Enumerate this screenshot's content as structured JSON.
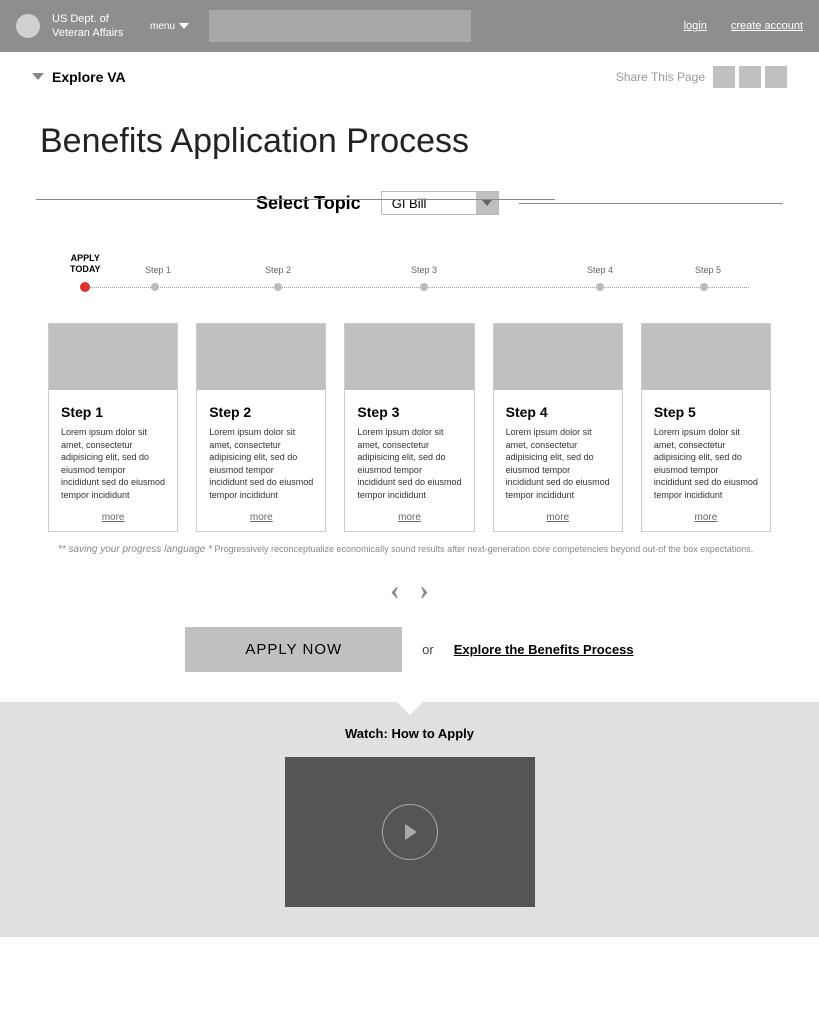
{
  "header": {
    "dept_name": "US Dept. of\nVeteran Affairs",
    "menu_label": "menu",
    "login": "login",
    "create_account": "create account"
  },
  "subheader": {
    "explore_label": "Explore VA",
    "share_label": "Share This Page"
  },
  "page_title": "Benefits Application Process",
  "topic": {
    "label": "Select Topic",
    "selected": "GI Bill"
  },
  "timeline": {
    "apply_today": "APPLY\nTODAY",
    "steps": [
      "Step 1",
      "Step 2",
      "Step 3",
      "Step 4",
      "Step 5"
    ]
  },
  "cards": [
    {
      "title": "Step 1",
      "text": "Lorem ipsum dolor sit amet, consectetur adipisicing elit, sed do eiusmod tempor incididunt sed do eiusmod tempor incididunt",
      "more": "more"
    },
    {
      "title": "Step 2",
      "text": "Lorem ipsum dolor sit amet, consectetur adipisicing elit, sed do eiusmod tempor incididunt sed do eiusmod tempor incididunt",
      "more": "more"
    },
    {
      "title": "Step 3",
      "text": "Lorem ipsum dolor sit amet, consectetur adipisicing elit, sed do eiusmod tempor incididunt sed do eiusmod tempor incididunt",
      "more": "more"
    },
    {
      "title": "Step 4",
      "text": "Lorem ipsum dolor sit amet, consectetur adipisicing elit, sed do eiusmod tempor incididunt sed do eiusmod tempor incididunt",
      "more": "more"
    },
    {
      "title": "Step 5",
      "text": "Lorem ipsum dolor sit amet, consectetur adipisicing elit, sed do eiusmod tempor incididunt sed do eiusmod tempor incididunt",
      "more": "more"
    }
  ],
  "footnote": {
    "lead": "** saving your progress language *",
    "rest": " Progressively reconceptualize economically sound results after next-generation core competencies beyond out-of the box expectations."
  },
  "cta": {
    "apply_now": "APPLY NOW",
    "or": "or",
    "explore_link": "Explore the Benefits Process"
  },
  "video": {
    "title": "Watch: How to Apply"
  }
}
